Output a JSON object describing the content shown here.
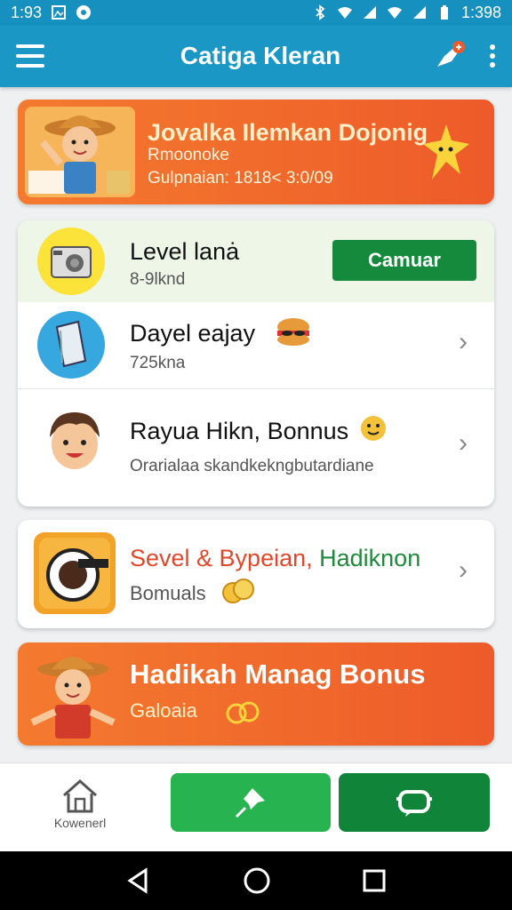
{
  "status": {
    "time": "1:93",
    "clock_right": "1:398"
  },
  "app_bar": {
    "title": "Catiga Kleran"
  },
  "banner_top": {
    "title": "Jovalka Ilemkan Dojonig",
    "line1": "Rmoonoke",
    "line2": "Gulpnaian: 1818< 3:0/09"
  },
  "list": {
    "row1": {
      "title": "Level lanȧ",
      "sub": "8-9lknd",
      "button": "Camuar"
    },
    "row2": {
      "title": "Dayel eajay",
      "sub": "725kna"
    },
    "row3": {
      "title": "Rayua Hikn, Bonnus",
      "sub": "Orarialaa skandkekngbutardiane"
    }
  },
  "card3": {
    "title_a": "Sevel & Bypeian,",
    "title_b": "Hadiknon",
    "sub": "Bomuals"
  },
  "banner_bottom": {
    "title": "Hadikah Manag Bonus",
    "sub": "Galoaia"
  },
  "bottom_nav": {
    "home_label": "Kowenerl"
  },
  "colors": {
    "primary": "#1a97c4",
    "accent_orange": "#f0682b",
    "button_green": "#168a3c",
    "bright_green": "#27b350"
  }
}
